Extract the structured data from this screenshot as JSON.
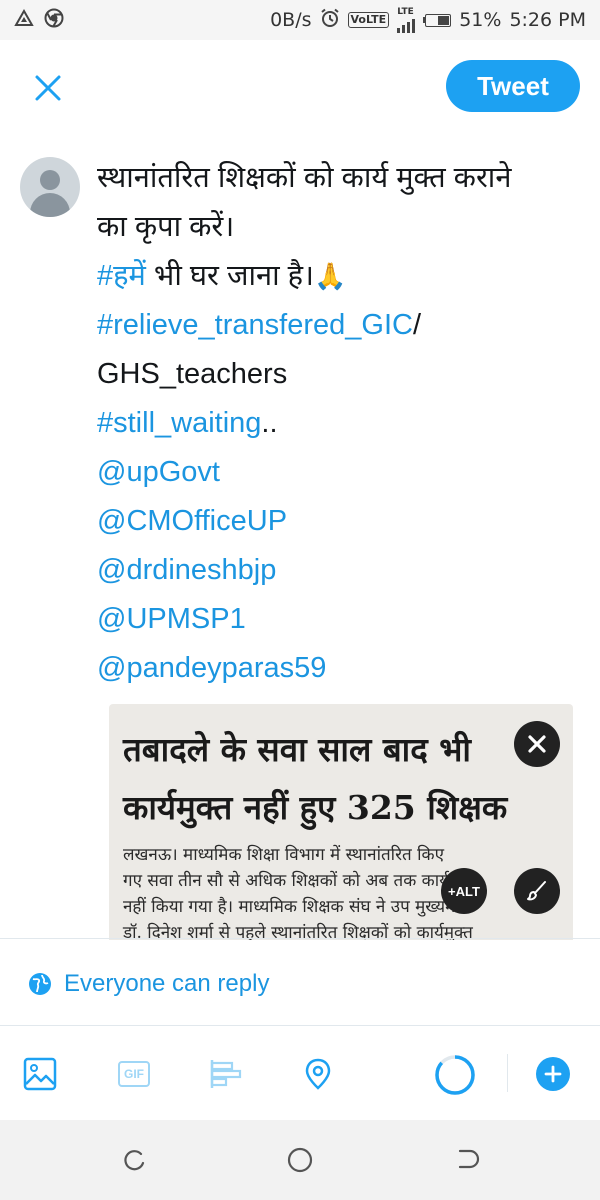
{
  "status_bar": {
    "network_speed": "0B/s",
    "volte": "VoLTE",
    "lte": "LTE",
    "battery": "51%",
    "time": "5:26 PM",
    "icons": [
      "notification-icon",
      "chrome-icon",
      "alarm-icon",
      "signal-icon",
      "battery-icon"
    ]
  },
  "compose": {
    "close_icon": "close-icon",
    "tweet_button": "Tweet"
  },
  "tweet": {
    "lines": [
      {
        "text": "स्थानांतरित शिक्षकों को कार्य मुक्त कराने",
        "link": false
      },
      {
        "text": "का कृपा करें।",
        "link": false
      },
      {
        "hashtag": "#हमें",
        "rest": " भी घर जाना है।",
        "emoji": "🙏"
      },
      {
        "link_text": "#relieve_transfered_GIC",
        "rest": "/"
      },
      {
        "text": "GHS_teachers",
        "link": false
      },
      {
        "link_text": "#still_waiting",
        "rest": ".."
      },
      {
        "text": "@upGovt",
        "link": true
      },
      {
        "text": "@CMOfficeUP",
        "link": true
      },
      {
        "text": "@drdineshbjp",
        "link": true
      },
      {
        "text": "@UPMSP1",
        "link": true
      },
      {
        "text": "@pandeyparas59",
        "link": true
      }
    ]
  },
  "attachment": {
    "headline_1": "तबादले के सवा साल बाद भी",
    "headline_2": "कार्यमुक्त नहीं हुए 325 शिक्षक",
    "body_lines": [
      "लखनऊ। माध्यमिक शिक्षा विभाग में स्थानांतरित किए",
      "गए सवा तीन सौ से अधिक शिक्षकों को अब तक कार्यमुक्त",
      "नहीं किया गया है। माध्यमिक शिक्षक संघ ने उप मुख्यमंत्री",
      "डॉ. दिनेश शर्मा से पहले स्थानांतरित शिक्षकों को कार्यमुक्त"
    ],
    "alt_label": "+ALT",
    "remove_icon": "close-icon",
    "edit_icon": "brush-icon"
  },
  "reply_setting": {
    "label": "Everyone can reply",
    "icon": "globe-icon"
  },
  "toolbar": {
    "gif_label": "GIF",
    "icons": [
      "image-icon",
      "gif-icon",
      "poll-icon",
      "location-icon",
      "character-counter",
      "add-icon"
    ]
  },
  "nav_bar": {
    "icons": [
      "recents-icon",
      "home-icon",
      "back-icon"
    ]
  },
  "colors": {
    "accent": "#1da1f2",
    "link": "#1b95e0",
    "text": "#14171a",
    "divider": "#e1e8ed"
  }
}
